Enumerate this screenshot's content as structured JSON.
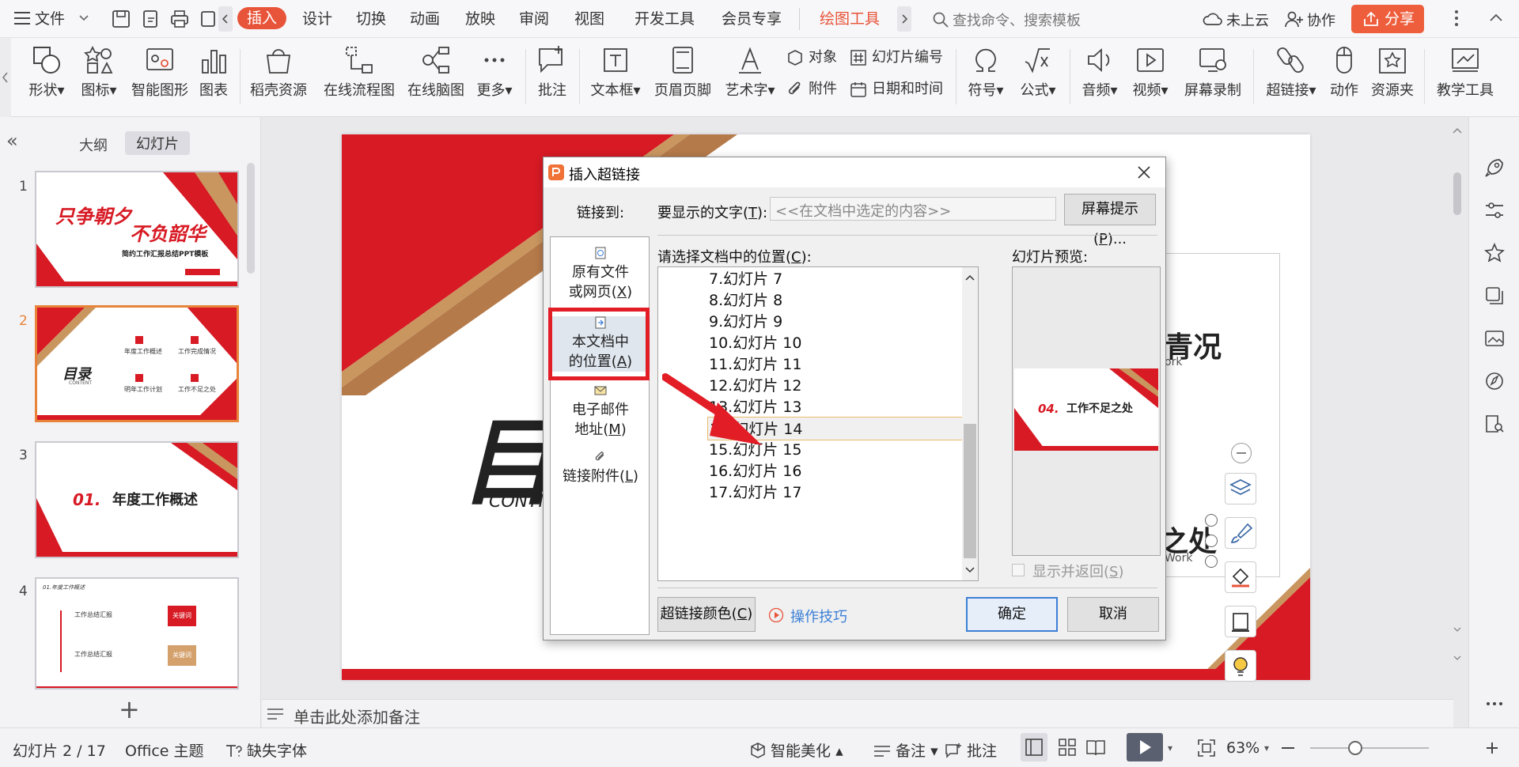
{
  "menubar": {
    "file": "文件",
    "tabs": [
      "插入",
      "设计",
      "切换",
      "动画",
      "放映",
      "审阅",
      "视图",
      "开发工具",
      "会员专享",
      "绘图工具"
    ],
    "active_tab": "插入",
    "search_placeholder": "查找命令、搜索模板",
    "cloud": "未上云",
    "collab": "协作",
    "share": "分享"
  },
  "ribbon": {
    "shape": "形状",
    "icon": "图标",
    "smartart": "智能图形",
    "chart": "图表",
    "resource": "稻壳资源",
    "flowchart": "在线流程图",
    "mindmap": "在线脑图",
    "more": "更多",
    "comment": "批注",
    "textbox": "文本框",
    "header_footer": "页眉页脚",
    "wordart": "艺术字",
    "object": "对象",
    "slide_number": "幻灯片编号",
    "attachment": "附件",
    "datetime": "日期和时间",
    "symbol": "符号",
    "formula": "公式",
    "audio": "音频",
    "video": "视频",
    "screen_record": "屏幕录制",
    "hyperlink": "超链接",
    "action": "动作",
    "resource_folder": "资源夹",
    "teach_tools": "教学工具"
  },
  "left_panel": {
    "tab_outline": "大纲",
    "tab_slides": "幻灯片",
    "collapse": "«",
    "add": "+",
    "thumbs": [
      {
        "num": "1",
        "line1": "只争朝夕",
        "line2": "不负韶华",
        "sub": "简约工作汇报总结PPT模板"
      },
      {
        "num": "2",
        "title": "目录",
        "sub": "CONTENT",
        "items": [
          "年度工作概述",
          "工作完成情况",
          "明年工作计划",
          "工作不足之处"
        ],
        "badges": [
          "01",
          "02",
          "03",
          "04"
        ]
      },
      {
        "num": "3",
        "index": "01.",
        "title": "年度工作概述"
      },
      {
        "num": "4",
        "header": "01.年度工作概述",
        "r1": "工作总结汇报",
        "r2": "工作总结汇报",
        "k1": "关键词",
        "k2": "关键词"
      }
    ]
  },
  "slide": {
    "big_title_partial": "目录",
    "content_partial": "CONTI",
    "right_text1": "青况",
    "right_sub1": "ork",
    "right_text2": "之处",
    "right_sub2": "Work"
  },
  "notes": {
    "placeholder": "单击此处添加备注"
  },
  "status": {
    "slide_info": "幻灯片 2 / 17",
    "theme": "Office 主题",
    "missing_font": "缺失字体",
    "beautify": "智能美化",
    "notes": "备注",
    "comments": "批注",
    "zoom": "63%"
  },
  "dialog": {
    "title": "插入超链接",
    "link_to": "链接到:",
    "display_text_label": "要显示的文字(",
    "display_text_key": "T",
    "display_text_label_end": "):",
    "display_text_placeholder": "<<在文档中选定的内容>>",
    "screen_tip": "屏幕提示(",
    "screen_tip_key": "P",
    "screen_tip_end": ")...",
    "link_items": [
      {
        "l1": "原有文件",
        "l2": "或网页(",
        "key": "X",
        "end": ")"
      },
      {
        "l1": "本文档中",
        "l2": "的位置(",
        "key": "A",
        "end": ")"
      },
      {
        "l1": "电子邮件",
        "l2": "地址(",
        "key": "M",
        "end": ")"
      },
      {
        "l1": "链接附件(",
        "key": "L",
        "end": ")"
      }
    ],
    "pos_label": "请选择文档中的位置(",
    "pos_key": "C",
    "pos_end": "):",
    "preview_label": "幻灯片预览:",
    "positions": [
      "7.幻灯片 7",
      "8.幻灯片 8",
      "9.幻灯片 9",
      "10.幻灯片 10",
      "11.幻灯片 11",
      "12.幻灯片 12",
      "13.幻灯片 13",
      "14.幻灯片 14",
      "15.幻灯片 15",
      "16.幻灯片 16",
      "17.幻灯片 17"
    ],
    "selected_position": "14.幻灯片 14",
    "preview_index": "04.",
    "preview_title": "工作不足之处",
    "show_return": "显示并返回(",
    "show_return_key": "S",
    "show_return_end": ")",
    "link_color": "超链接颜色(",
    "link_color_key": "C",
    "link_color_end": ")",
    "tips": "操作技巧",
    "ok": "确定",
    "cancel": "取消"
  },
  "colors": {
    "accent": "#e8543a",
    "brand_red": "#d71a24",
    "highlight_box": "#e21d26",
    "link_blue": "#3c7fd6"
  }
}
